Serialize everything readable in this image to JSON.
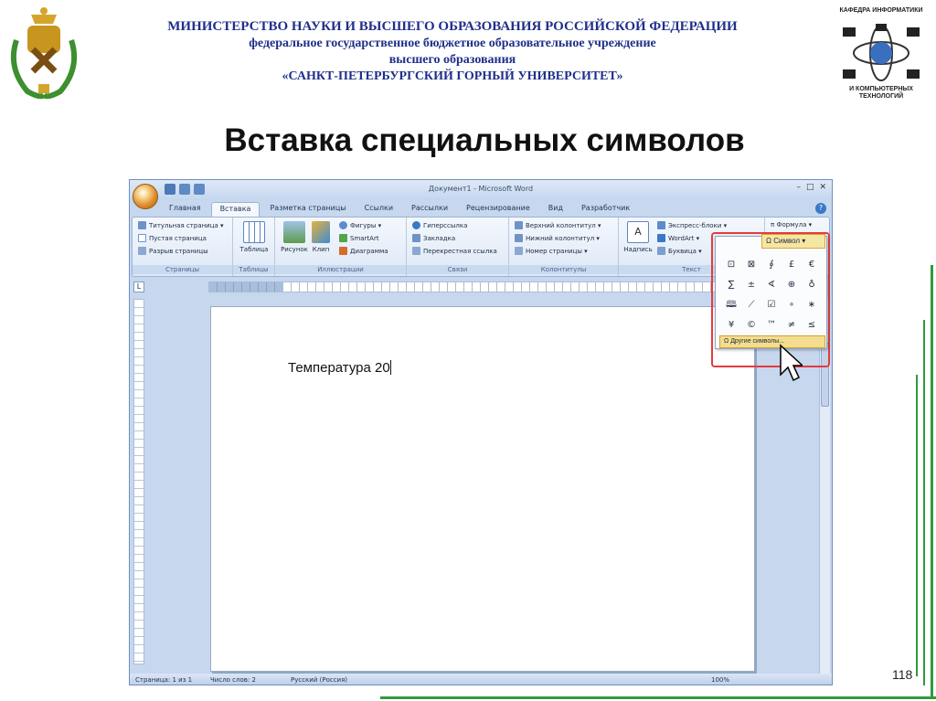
{
  "header": {
    "ministry": "МИНИСТЕРСТВО НАУКИ И ВЫСШЕГО ОБРАЗОВАНИЯ РОССИЙСКОЙ ФЕДЕРАЦИИ",
    "institution_line1": "федеральное государственное бюджетное образовательное учреждение",
    "institution_line2": "высшего образования",
    "university": "«САНКТ-ПЕТЕРБУРГСКИЙ ГОРНЫЙ УНИВЕРСИТЕТ»"
  },
  "logo_right": {
    "top_caption": "КАФЕДРА ИНФОРМАТИКИ",
    "bottom_caption_1": "И КОМПЬЮТЕРНЫХ",
    "bottom_caption_2": "ТЕХНОЛОГИЙ"
  },
  "slide": {
    "title": "Вставка специальных символов",
    "page_number": "118"
  },
  "word": {
    "window_title": "Документ1 - Microsoft Word",
    "tabs": [
      "Главная",
      "Вставка",
      "Разметка страницы",
      "Ссылки",
      "Рассылки",
      "Рецензирование",
      "Вид",
      "Разработчик"
    ],
    "groups": {
      "pages": {
        "label": "Страницы",
        "items": [
          "Титульная страница ▾",
          "Пустая страница",
          "Разрыв страницы"
        ]
      },
      "tables": {
        "label": "Таблицы",
        "button": "Таблица"
      },
      "illustrations": {
        "label": "Иллюстрации",
        "big": [
          "Рисунок",
          "Клип"
        ],
        "items": [
          "Фигуры ▾",
          "SmartArt",
          "Диаграмма"
        ]
      },
      "links": {
        "label": "Связи",
        "items": [
          "Гиперссылка",
          "Закладка",
          "Перекрестная ссылка"
        ]
      },
      "headers": {
        "label": "Колонтитулы",
        "items": [
          "Верхний колонтитул ▾",
          "Нижний колонтитул ▾",
          "Номер страницы ▾"
        ]
      },
      "text": {
        "label": "Текст",
        "big": "Надпись",
        "items": [
          "Экспресс-блоки ▾",
          "WordArt ▾",
          "Буквица ▾"
        ]
      },
      "symbols": {
        "formula": "π Формула ▾",
        "symbol": "Ω Символ ▾"
      }
    },
    "document_text": "Температура 20",
    "symbol_grid": [
      "⊡",
      "⊠",
      "∮",
      "£",
      "€",
      "∑",
      "±",
      "∢",
      "⊕",
      "♁",
      "🕮",
      "⟋",
      "☑",
      "∘",
      "∗",
      "¥",
      "©",
      "™",
      "≠",
      "≤"
    ],
    "more_symbols": "Другие символы...",
    "status": {
      "page": "Страница: 1 из 1",
      "words": "Число слов: 2",
      "language": "Русский (Россия)",
      "zoom": "100%"
    }
  },
  "colors": {
    "header_blue": "#1f2f8a",
    "frame_green": "#2f9a3c",
    "highlight_red": "#e43c3c"
  }
}
